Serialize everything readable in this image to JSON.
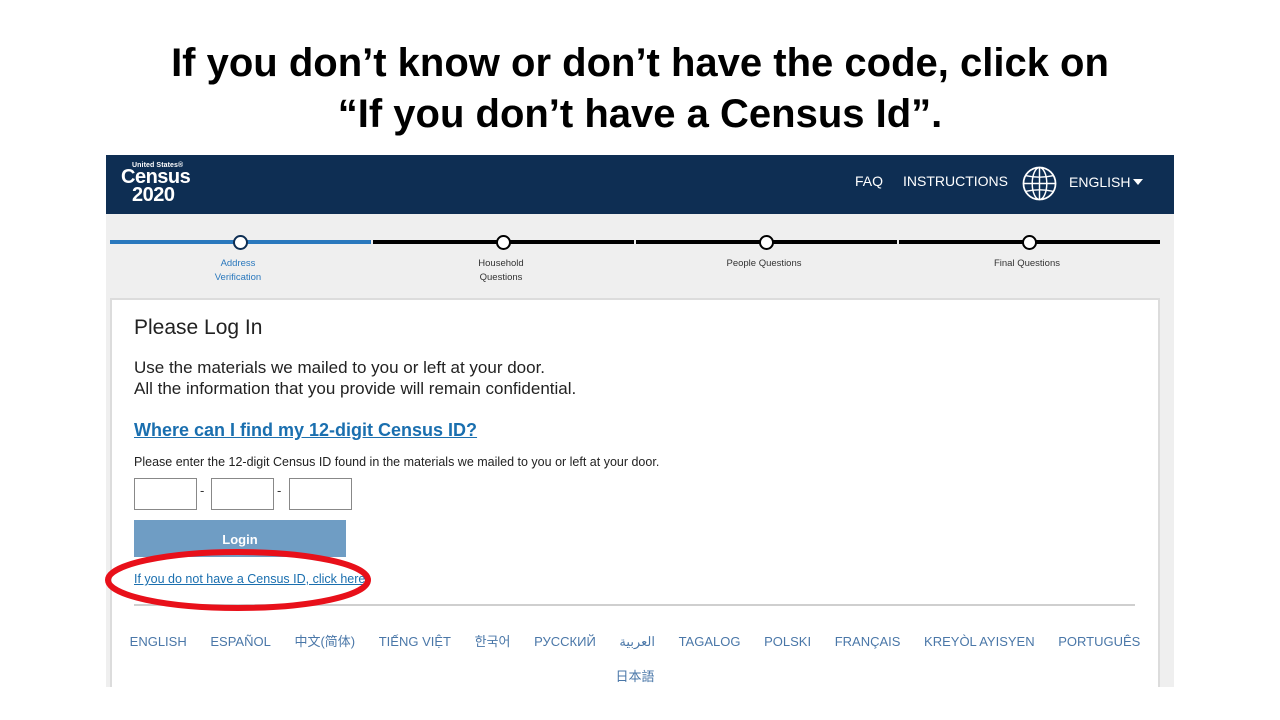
{
  "slide": {
    "title_line1": "If you don’t know or don’t have the code, click on",
    "title_line2": "“If you don’t have a Census Id”."
  },
  "header": {
    "logo": {
      "top": "United States®",
      "name": "Census",
      "year": "2020"
    },
    "nav": {
      "faq": "FAQ",
      "instructions": "INSTRUCTIONS",
      "language": "ENGLISH"
    },
    "colors": {
      "background": "#0e2e53"
    }
  },
  "progress": {
    "steps": [
      {
        "label_line1": "Address",
        "label_line2": "Verification",
        "active": true
      },
      {
        "label_line1": "Household",
        "label_line2": "Questions",
        "active": false
      },
      {
        "label_line1": "People Questions",
        "label_line2": "",
        "active": false
      },
      {
        "label_line1": "Final Questions",
        "label_line2": "",
        "active": false
      }
    ],
    "colors": {
      "active": "#2a78bd",
      "inactive": "#000000"
    }
  },
  "login": {
    "heading": "Please Log In",
    "intro_line1": "Use the materials we mailed to you or left at your door.",
    "intro_line2": "All the information that you provide will remain confidential.",
    "help_link": "Where can I find my 12-digit Census ID?",
    "instruction": "Please enter the 12-digit Census ID found in the materials we mailed to you or left at your door.",
    "id_fields": [
      "",
      "",
      ""
    ],
    "separator": "-",
    "button": "Login",
    "no_id_link": "If you do not have a Census ID, click here"
  },
  "languages": [
    "ENGLISH",
    "ESPAÑOL",
    "中文(简体)",
    "TIẾNG VIỆT",
    "한국어",
    "РУССКИЙ",
    "العربية",
    "TAGALOG",
    "POLSKI",
    "FRANÇAIS",
    "KREYÒL AYISYEN",
    "PORTUGUÊS"
  ],
  "language_extra": "日本語",
  "annotation": {
    "color": "#e8101a"
  }
}
